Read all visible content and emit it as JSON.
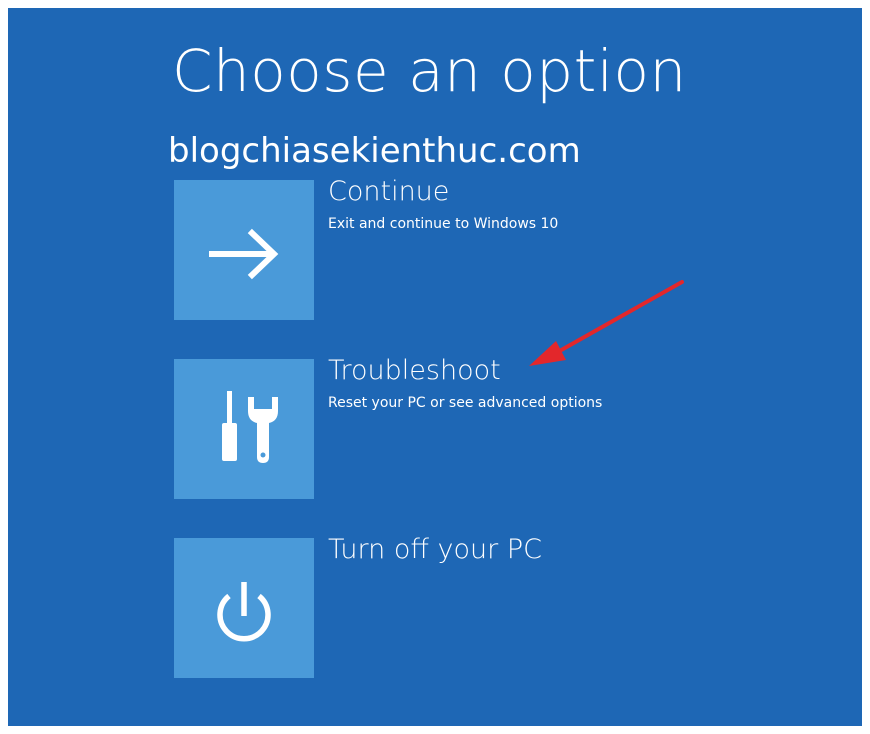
{
  "screen": {
    "title": "Choose an option",
    "watermark": "blogchiasekienthuc.com",
    "background_color": "#1e67b5",
    "tile_color": "#4a9ad9",
    "annotation_color": "#e3272b"
  },
  "options": [
    {
      "label": "Continue",
      "description": "Exit and continue to Windows 10",
      "icon": "arrow-right-icon"
    },
    {
      "label": "Troubleshoot",
      "description": "Reset your PC or see advanced options",
      "icon": "tools-icon"
    },
    {
      "label": "Turn off your PC",
      "description": "",
      "icon": "power-icon"
    }
  ]
}
